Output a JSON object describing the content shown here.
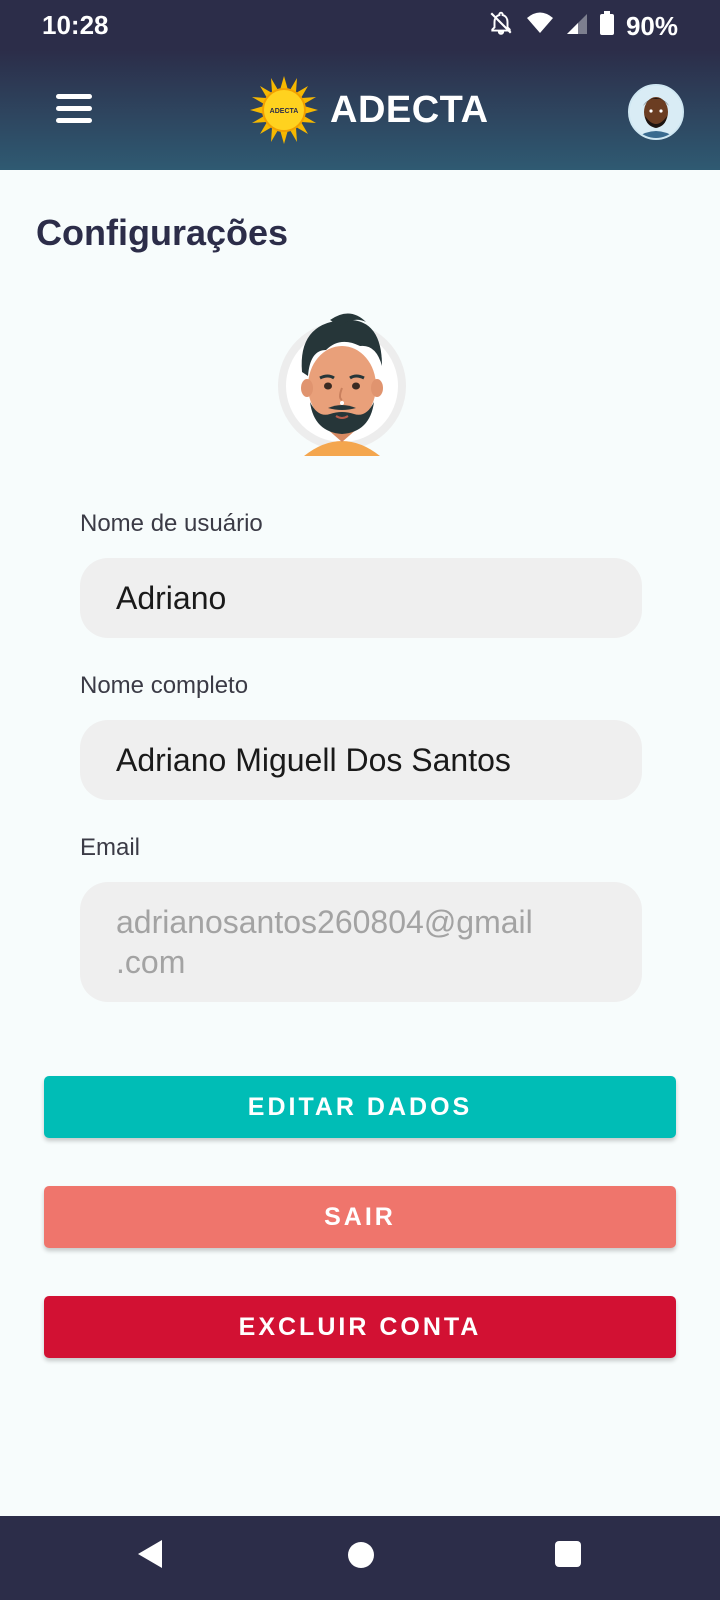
{
  "status_bar": {
    "time": "10:28",
    "battery": "90%",
    "icons": [
      "bell-off-icon",
      "wifi-icon",
      "signal-icon",
      "battery-icon"
    ]
  },
  "header": {
    "app_name": "ADECTA",
    "logo_text": "ADECTA",
    "icons": [
      "menu-icon",
      "sun-logo",
      "avatar"
    ]
  },
  "page": {
    "title": "Configurações"
  },
  "form": {
    "username_label": "Nome de usuário",
    "username_value": "Adriano",
    "fullname_label": "Nome completo",
    "fullname_value": "Adriano Miguell Dos Santos",
    "email_label": "Email",
    "email_value_line1": "adrianosantos260804@gmail",
    "email_value_line2": ".com"
  },
  "buttons": {
    "edit": "EDITAR DADOS",
    "logout": "SAIR",
    "delete": "EXCLUIR CONTA"
  },
  "colors": {
    "header_dark": "#2c2d49",
    "header_teal": "#2f5a72",
    "edit": "#00bdb6",
    "logout": "#ef756c",
    "delete": "#d21133"
  }
}
